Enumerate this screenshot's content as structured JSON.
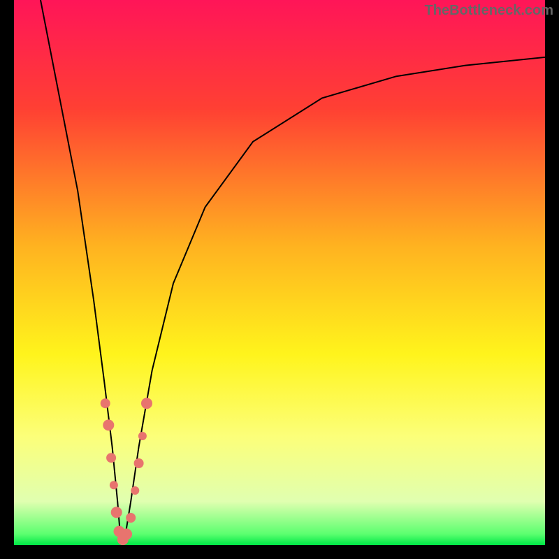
{
  "watermark": "TheBottleneck.com",
  "chart_data": {
    "type": "line",
    "title": "",
    "xlabel": "",
    "ylabel": "",
    "xlim": [
      0,
      100
    ],
    "ylim": [
      0,
      100
    ],
    "gradient_stops": [
      {
        "offset": 0,
        "color": "#ff1558"
      },
      {
        "offset": 20,
        "color": "#ff4033"
      },
      {
        "offset": 45,
        "color": "#ffb220"
      },
      {
        "offset": 65,
        "color": "#fff41c"
      },
      {
        "offset": 80,
        "color": "#fcff79"
      },
      {
        "offset": 92,
        "color": "#e0ffb0"
      },
      {
        "offset": 98,
        "color": "#5bff6f"
      },
      {
        "offset": 100,
        "color": "#00e846"
      }
    ],
    "series": [
      {
        "name": "v-curve",
        "type": "line",
        "color": "#000000",
        "x": [
          5,
          8,
          12,
          15,
          17,
          18.5,
          19.5,
          20,
          20.5,
          21,
          22,
          23.5,
          26,
          30,
          36,
          45,
          58,
          72,
          85,
          100
        ],
        "y": [
          100,
          85,
          65,
          45,
          30,
          18,
          8,
          2,
          1,
          2,
          8,
          18,
          32,
          48,
          62,
          74,
          82,
          86,
          88,
          89.5
        ]
      }
    ],
    "markers": [
      {
        "x": 17.2,
        "y": 26,
        "r": 7,
        "color": "#e8746e"
      },
      {
        "x": 17.8,
        "y": 22,
        "r": 8,
        "color": "#e8746e"
      },
      {
        "x": 18.3,
        "y": 16,
        "r": 7,
        "color": "#e8746e"
      },
      {
        "x": 18.8,
        "y": 11,
        "r": 6,
        "color": "#e8746e"
      },
      {
        "x": 19.3,
        "y": 6,
        "r": 8,
        "color": "#e8746e"
      },
      {
        "x": 19.8,
        "y": 2.5,
        "r": 8,
        "color": "#e8746e"
      },
      {
        "x": 20.5,
        "y": 1,
        "r": 8,
        "color": "#e8746e"
      },
      {
        "x": 21.2,
        "y": 2,
        "r": 8,
        "color": "#e8746e"
      },
      {
        "x": 22,
        "y": 5,
        "r": 7,
        "color": "#e8746e"
      },
      {
        "x": 22.8,
        "y": 10,
        "r": 6,
        "color": "#e8746e"
      },
      {
        "x": 23.5,
        "y": 15,
        "r": 7,
        "color": "#e8746e"
      },
      {
        "x": 24.2,
        "y": 20,
        "r": 6,
        "color": "#e8746e"
      },
      {
        "x": 25,
        "y": 26,
        "r": 8,
        "color": "#e8746e"
      }
    ]
  }
}
